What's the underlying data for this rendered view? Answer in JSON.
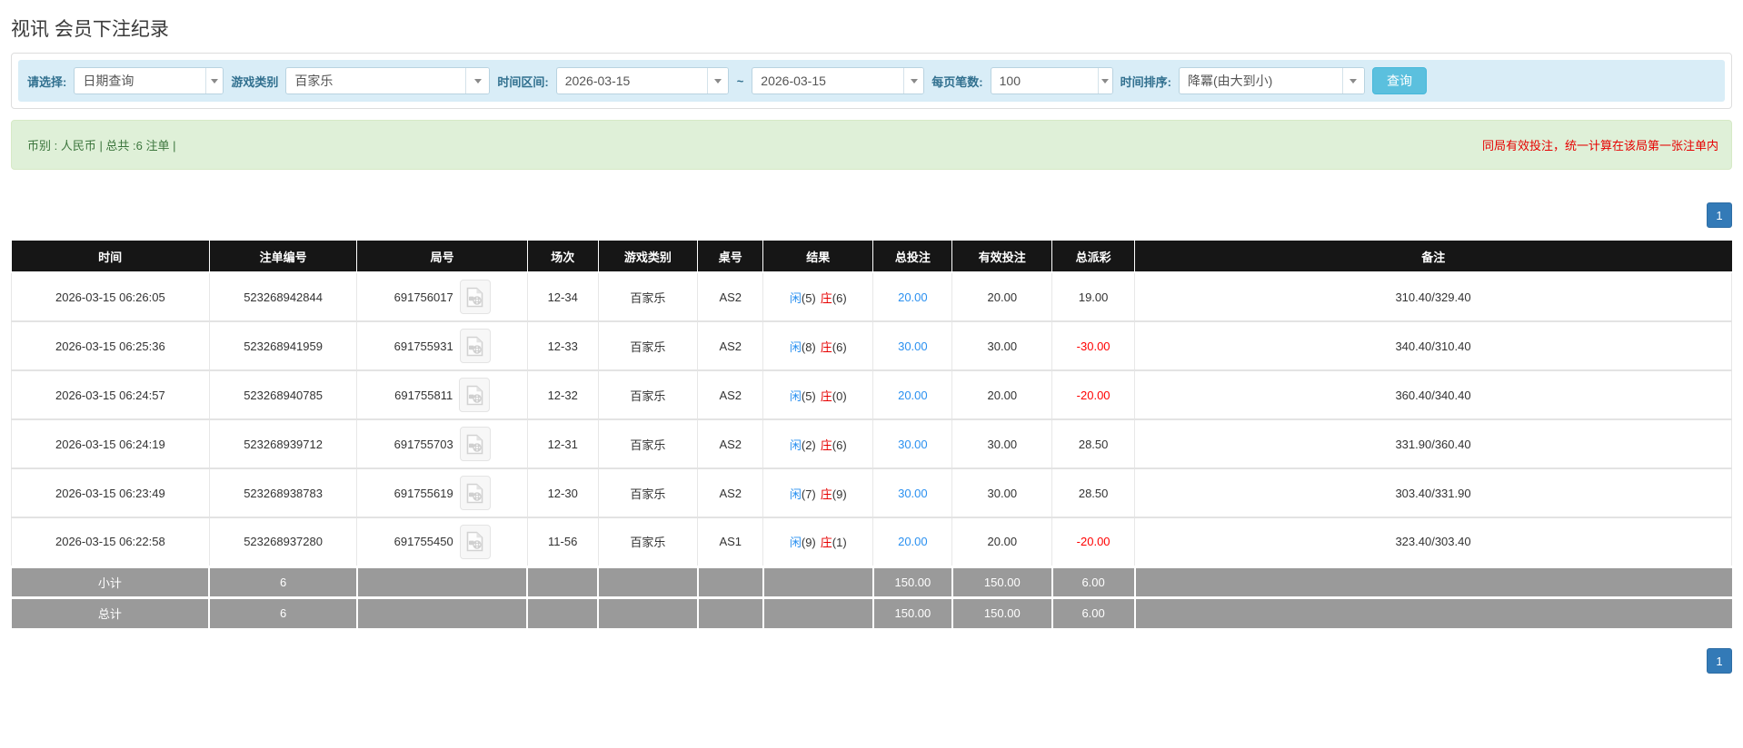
{
  "title": "视讯 会员下注纪录",
  "filters": {
    "select_label": "请选择:",
    "query_type": "日期查询",
    "game_category_label": "游戏类别",
    "game_category": "百家乐",
    "time_range_label": "时间区间:",
    "date_from": "2026-03-15",
    "range_separator": "~",
    "date_to": "2026-03-15",
    "page_size_label": "每页笔数:",
    "page_size": "100",
    "sort_label": "时间排序:",
    "sort_order": "降冪(由大到小)",
    "search_button": "查询"
  },
  "info_bar": {
    "summary": "币别 : 人民币 | 总共 :6 注单 |",
    "notice": "同局有效投注，统一计算在该局第一张注单内"
  },
  "pagination": {
    "current_page": "1"
  },
  "table": {
    "headers": {
      "time": "时间",
      "order_no": "注单编号",
      "round_no": "局号",
      "session": "场次",
      "game": "游戏类别",
      "table_no": "桌号",
      "result": "结果",
      "total_bet": "总投注",
      "valid_bet": "有效投注",
      "payout": "总派彩",
      "remark": "备注"
    },
    "rows": [
      {
        "time": "2026-03-15 06:26:05",
        "order_no": "523268942844",
        "round_no": "691756017",
        "session": "12-34",
        "game": "百家乐",
        "table_no": "AS2",
        "player": "闲",
        "player_n": "(5)",
        "banker": "庄",
        "banker_n": "(6)",
        "total_bet": "20.00",
        "valid_bet": "20.00",
        "payout": "19.00",
        "remark": "310.40/329.40"
      },
      {
        "time": "2026-03-15 06:25:36",
        "order_no": "523268941959",
        "round_no": "691755931",
        "session": "12-33",
        "game": "百家乐",
        "table_no": "AS2",
        "player": "闲",
        "player_n": "(8)",
        "banker": "庄",
        "banker_n": "(6)",
        "total_bet": "30.00",
        "valid_bet": "30.00",
        "payout": "-30.00",
        "remark": "340.40/310.40"
      },
      {
        "time": "2026-03-15 06:24:57",
        "order_no": "523268940785",
        "round_no": "691755811",
        "session": "12-32",
        "game": "百家乐",
        "table_no": "AS2",
        "player": "闲",
        "player_n": "(5)",
        "banker": "庄",
        "banker_n": "(0)",
        "total_bet": "20.00",
        "valid_bet": "20.00",
        "payout": "-20.00",
        "remark": "360.40/340.40"
      },
      {
        "time": "2026-03-15 06:24:19",
        "order_no": "523268939712",
        "round_no": "691755703",
        "session": "12-31",
        "game": "百家乐",
        "table_no": "AS2",
        "player": "闲",
        "player_n": "(2)",
        "banker": "庄",
        "banker_n": "(6)",
        "total_bet": "30.00",
        "valid_bet": "30.00",
        "payout": "28.50",
        "remark": "331.90/360.40"
      },
      {
        "time": "2026-03-15 06:23:49",
        "order_no": "523268938783",
        "round_no": "691755619",
        "session": "12-30",
        "game": "百家乐",
        "table_no": "AS2",
        "player": "闲",
        "player_n": "(7)",
        "banker": "庄",
        "banker_n": "(9)",
        "total_bet": "30.00",
        "valid_bet": "30.00",
        "payout": "28.50",
        "remark": "303.40/331.90"
      },
      {
        "time": "2026-03-15 06:22:58",
        "order_no": "523268937280",
        "round_no": "691755450",
        "session": "11-56",
        "game": "百家乐",
        "table_no": "AS1",
        "player": "闲",
        "player_n": "(9)",
        "banker": "庄",
        "banker_n": "(1)",
        "total_bet": "20.00",
        "valid_bet": "20.00",
        "payout": "-20.00",
        "remark": "323.40/303.40"
      }
    ],
    "subtotal": {
      "label": "小计",
      "count": "6",
      "total_bet": "150.00",
      "valid_bet": "150.00",
      "payout": "6.00"
    },
    "grand_total": {
      "label": "总计",
      "count": "6",
      "total_bet": "150.00",
      "valid_bet": "150.00",
      "payout": "6.00"
    }
  },
  "colors": {
    "filter_bar_bg": "#d9edf7",
    "info_bar_bg": "#dff0d8",
    "search_button": "#5bc0de",
    "pager_button": "#337ab7",
    "header_bg": "#161616",
    "summary_row_bg": "#9a9a9a",
    "player_blue": "#2a90f0",
    "banker_red": "#e60000",
    "negative_red": "#ff0000"
  }
}
